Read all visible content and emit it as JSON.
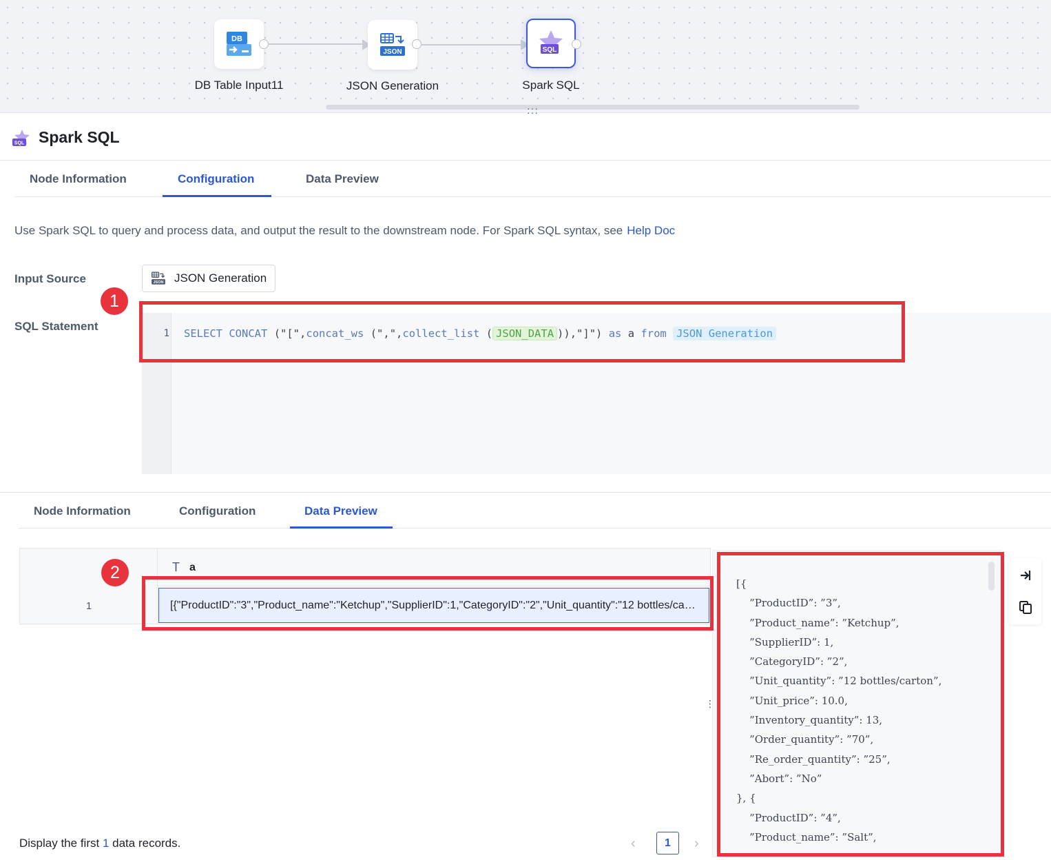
{
  "flow": {
    "nodes": [
      {
        "label": "DB Table Input11",
        "icon": "db-table-input-icon"
      },
      {
        "label": "JSON Generation",
        "icon": "json-generation-icon"
      },
      {
        "label": "Spark SQL",
        "icon": "spark-sql-icon",
        "selected": true
      }
    ]
  },
  "panel": {
    "title": "Spark SQL",
    "top_tabs": [
      "Node Information",
      "Configuration",
      "Data Preview"
    ],
    "top_active_tab": "Configuration",
    "description": "Use Spark SQL to query and process data, and output the result to the downstream node. For Spark SQL syntax, see",
    "help_link": "Help Doc",
    "input_source_label": "Input Source",
    "input_source_value": "JSON Generation",
    "sql_label": "SQL Statement",
    "sql": {
      "line_number": "1",
      "select": "SELECT",
      "concat": "CONCAT",
      "p1": "(\"[\",",
      "concat_ws": "concat_ws",
      "p2": "(\",\",",
      "collect_list": "collect_list",
      "p3": "(",
      "column_token": "JSON_DATA",
      "p4": ")),\"]\")",
      "as": "as",
      "alias": "a",
      "from": "from",
      "table_token": "JSON Generation"
    }
  },
  "preview": {
    "tabs": [
      "Node Information",
      "Configuration",
      "Data Preview"
    ],
    "active_tab": "Data Preview",
    "column_type_icon": "T",
    "column_name": "a",
    "row_number": "1",
    "cell_value": "[{\"ProductID\":\"3\",\"Product_name\":\"Ketchup\",\"SupplierID\":1,\"CategoryID\":\"2\",\"Unit_quantity\":\"12 bottles/carton\",\"Unit_price\":10.0,\"Inventory_quantity\":13,\"Order_quantity\":\"70\",\"Re_order_quantity\":\"25\",\"Abort\":\"No\"},{\"ProductID\":\"4\",\"Product_name\":\"Salt\"",
    "json_lines": [
      "[{",
      "    ”ProductID”: ”3”,",
      "    ”Product_name”: ”Ketchup”,",
      "    ”SupplierID”: 1,",
      "    ”CategoryID”: ”2”,",
      "    ”Unit_quantity”: ”12 bottles/carton”,",
      "    ”Unit_price”: 10.0,",
      "    ”Inventory_quantity”: 13,",
      "    ”Order_quantity”: ”70”,",
      "    ”Re_order_quantity”: ”25”,",
      "    ”Abort”: ”No”",
      "}, {",
      "    ”ProductID”: ”4”,",
      "    ”Product_name”: ”Salt”,"
    ],
    "footer_prefix": "Display the first",
    "footer_count": "1",
    "footer_suffix": "data records.",
    "current_page": "1"
  },
  "annotations": {
    "badge1": "1",
    "badge2": "2",
    "color": "#e8323c"
  },
  "colors": {
    "accent": "#2b57d6",
    "annotation": "#e8323c"
  }
}
